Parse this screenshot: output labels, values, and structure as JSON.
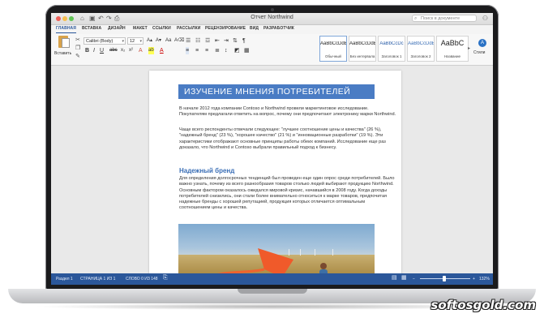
{
  "window": {
    "title": "Отчет Northwind",
    "search_placeholder": "Поиск в документе"
  },
  "tabs": [
    "ГЛАВНАЯ",
    "ВСТАВКА",
    "ДИЗАЙН",
    "МАКЕТ",
    "ССЫЛКИ",
    "РАССЫЛКИ",
    "РЕЦЕНЗИРОВАНИЕ",
    "ВИД",
    "РАЗРАБОТЧИК"
  ],
  "ribbon": {
    "paste_label": "Вставить",
    "font_name": "Calibri (Body)",
    "font_size": "12",
    "styles": [
      {
        "sample": "AaBbCcDdEe",
        "name": "Обычный"
      },
      {
        "sample": "AaBbCcDdEe",
        "name": "Без интервала"
      },
      {
        "sample": "AaBbCcDc",
        "name": "Заголовок 1"
      },
      {
        "sample": "AaBbCcDdE",
        "name": "Заголовок 2"
      },
      {
        "sample": "AaBbC",
        "name": "Название"
      }
    ],
    "styles_pane_label": "Стили"
  },
  "document": {
    "heading": "ИЗУЧЕНИЕ МНЕНИЯ ПОТРЕБИТЕЛЕЙ",
    "para1": "В начале 2012 года компании Contoso и Northwind провели маркетинговое исследование. Покупателям предлагали ответить на вопрос, почему они предпочитают электронику марки Northwind.",
    "para2": "Чаще всего респонденты отвечали следующее: \"лучшее соотношение цены и качества\" (26 %), \"надежный бренд\" (23 %), \"хорошее качество\" (21 %) и \"инновационные разработки\" (19 %). Эти характеристики отображают основные принципы работы обеих компаний. Исследование еще раз доказало, что Northwind и Contoso выбрали правильный подход к бизнесу.",
    "subheading": "Надежный бренд",
    "para3": "Для определения долгосрочных тенденций был проведен еще один опрос среди потребителей. Было важно узнать, почему из всего разнообразия товаров столько людей выбирают продукцию Northwind. Основным фактором оказалось ожидался мировой кризис, начавшийся в 2008 году. Когда доходы потребителей снизились, они стали более внимательно относиться к марке товаров, предпочитая надежные бренды с хорошей репутацией, продукция которых отличается оптимальным соотношением цены и качества."
  },
  "status_bar": {
    "section": "Раздел 1",
    "page": "СТРАНИЦА 1 ИЗ 1",
    "words": "СЛОВО 0 ИЗ 148",
    "zoom": "132%"
  },
  "watermark": "softosgold.com",
  "colors": {
    "accent": "#2b579a",
    "heading_bg": "#4a7cc4",
    "subheading": "#3b6fb6"
  }
}
